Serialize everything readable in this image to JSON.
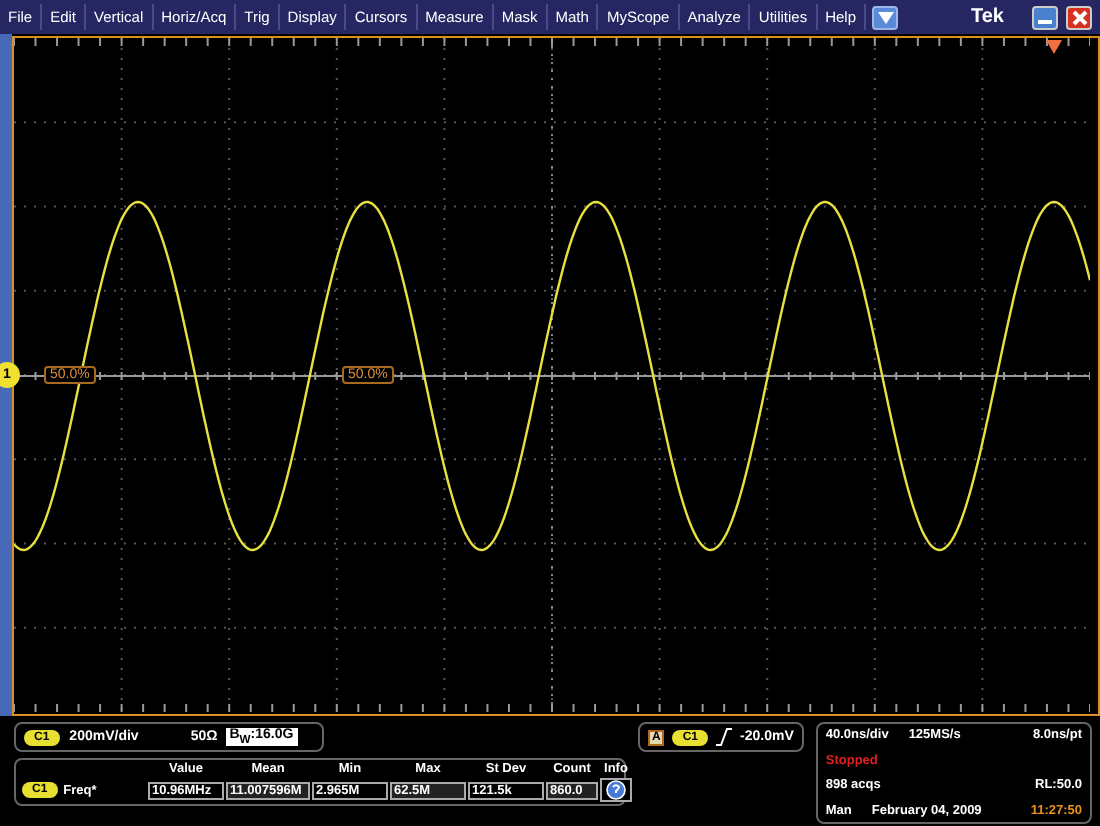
{
  "menu": {
    "items": [
      "File",
      "Edit",
      "Vertical",
      "Horiz/Acq",
      "Trig",
      "Display",
      "Cursors",
      "Measure",
      "Mask",
      "Math",
      "MyScope",
      "Analyze",
      "Utilities",
      "Help"
    ],
    "brand": "Tek"
  },
  "plot": {
    "channel_marker": "1",
    "reference_labels": [
      "50.0%",
      "50.0%"
    ]
  },
  "channel_box": {
    "badge": "C1",
    "scale": "200mV/div",
    "impedance": "50Ω",
    "bandwidth": "B$_{W}$:16.0G"
  },
  "measurements": {
    "columns": [
      "Value",
      "Mean",
      "Min",
      "Max",
      "St Dev",
      "Count",
      "Info"
    ],
    "rows": [
      {
        "badge": "C1",
        "name": "Freq*",
        "cells": [
          "10.96MHz",
          "11.007596M",
          "2.965M",
          "62.5M",
          "121.5k",
          "860.0"
        ]
      }
    ]
  },
  "trigger": {
    "source": "A",
    "badge": "C1",
    "level": "-20.0mV"
  },
  "acquisition": {
    "timebase": "40.0ns/div",
    "sample_rate": "125MS/s",
    "resolution": "8.0ns/pt",
    "state": "Stopped",
    "acquisitions": "898 acqs",
    "record_length": "RL:50.0",
    "mode": "Man",
    "date": "February 04, 2009",
    "time": "11:27:50"
  }
}
